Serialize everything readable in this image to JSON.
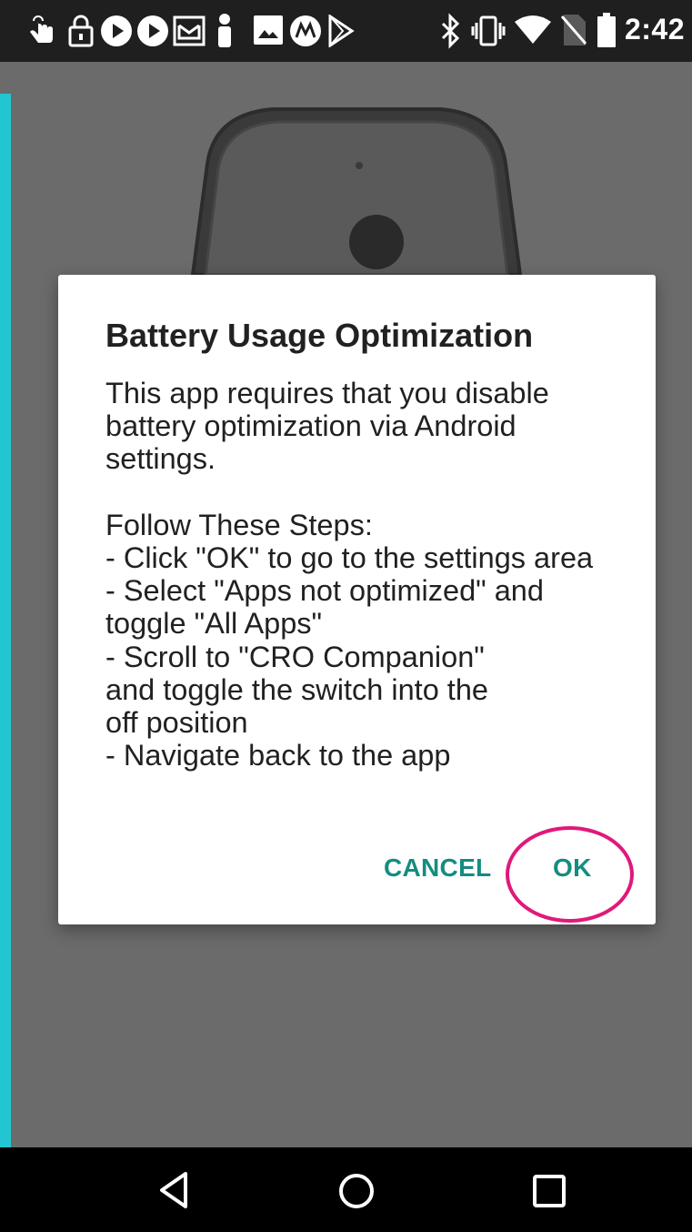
{
  "status_bar": {
    "time": "2:42",
    "left_icons": [
      "touch-icon",
      "lock-icon",
      "play-icon",
      "play-icon",
      "mail-icon",
      "person-icon",
      "image-icon",
      "motorola-icon",
      "play-store-icon"
    ],
    "right_icons": [
      "bluetooth-icon",
      "vibrate-icon",
      "wifi-icon",
      "no-sim-icon",
      "battery-icon"
    ]
  },
  "dialog": {
    "title": "Battery Usage Optimization",
    "message_intro": "This app requires that you disable\nbattery optimization via Android\nsettings.",
    "steps_heading": "Follow These Steps:",
    "steps": [
      "- Click \"OK\" to go to the settings area",
      "- Select \"Apps not optimized\" and\ntoggle \"All Apps\"",
      "- Scroll to \"CRO Companion\"\nand toggle the switch into the\noff position",
      "- Navigate back to the app"
    ],
    "cancel_label": "CANCEL",
    "ok_label": "OK"
  },
  "colors": {
    "accent": "#22c6d3",
    "button_text": "#148d80",
    "highlight": "#e0197a",
    "scrim_background": "#6b6b6b"
  },
  "nav_bar": {
    "icons": [
      "back-icon",
      "home-icon",
      "recents-icon"
    ]
  }
}
